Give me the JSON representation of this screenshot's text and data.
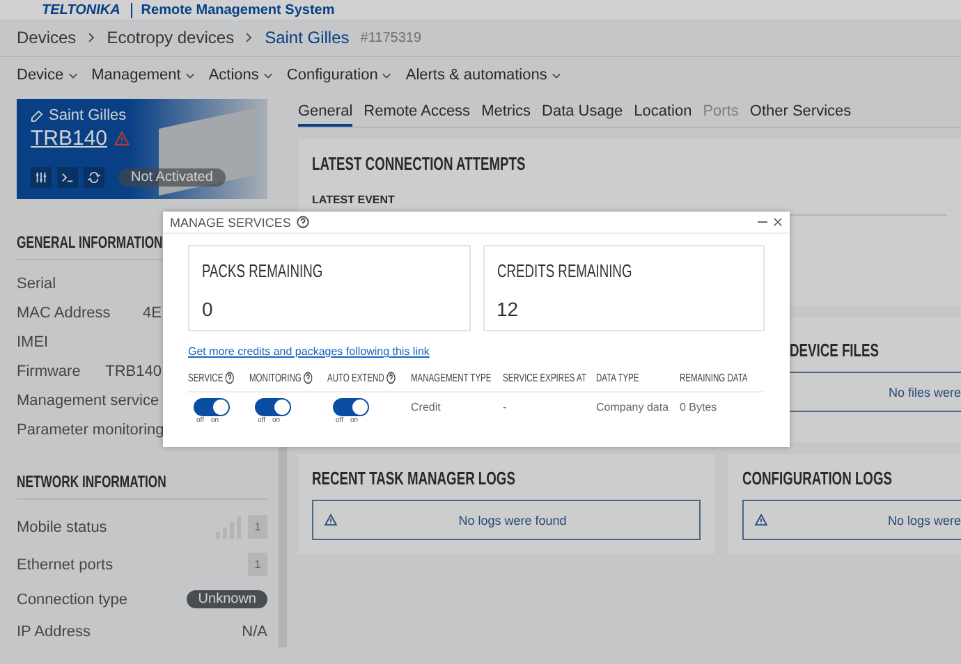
{
  "header": {
    "logo": "TELTONIKA",
    "title": "Remote Management System"
  },
  "breadcrumbs": [
    {
      "label": "Devices",
      "current": false
    },
    {
      "label": "Ecotropy devices",
      "current": false
    },
    {
      "label": "Saint Gilles",
      "current": true
    }
  ],
  "device_id": "#1175319",
  "menu": [
    "Device",
    "Management",
    "Actions",
    "Configuration",
    "Alerts & automations"
  ],
  "device_card": {
    "name": "Saint Gilles",
    "model": "TRB140",
    "warning": true,
    "status": "Not Activated"
  },
  "general_information": {
    "title": "GENERAL INFORMATION",
    "rows": [
      {
        "label": "Serial"
      },
      {
        "label": "MAC Address",
        "value": "4E"
      },
      {
        "label": "IMEI"
      },
      {
        "label": "Firmware",
        "value": "TRB140"
      },
      {
        "label": "Management service"
      },
      {
        "label": "Parameter monitoring"
      }
    ]
  },
  "network_information": {
    "title": "NETWORK INFORMATION",
    "rows": [
      {
        "label": "Mobile status",
        "kind": "signal",
        "value": "1"
      },
      {
        "label": "Ethernet ports",
        "kind": "port",
        "value": "1"
      },
      {
        "label": "Connection type",
        "kind": "badge",
        "value": "Unknown"
      },
      {
        "label": "IP Address",
        "kind": "text",
        "value": "N/A"
      }
    ]
  },
  "tabs": [
    {
      "label": "General",
      "selected": true,
      "disabled": false
    },
    {
      "label": "Remote Access",
      "selected": false,
      "disabled": false
    },
    {
      "label": "Metrics",
      "selected": false,
      "disabled": false
    },
    {
      "label": "Data Usage",
      "selected": false,
      "disabled": false
    },
    {
      "label": "Location",
      "selected": false,
      "disabled": false
    },
    {
      "label": "Ports",
      "selected": false,
      "disabled": true
    },
    {
      "label": "Other Services",
      "selected": false,
      "disabled": false
    }
  ],
  "latest_connection": {
    "title": "LATEST CONNECTION ATTEMPTS",
    "label": "LATEST EVENT"
  },
  "device_files": {
    "title": "DEVICE FILES",
    "message": "No files were"
  },
  "task_logs": {
    "title": "RECENT TASK MANAGER LOGS",
    "message": "No logs were found"
  },
  "config_logs": {
    "title": "CONFIGURATION LOGS",
    "message": "No logs were"
  },
  "dialog": {
    "title": "MANAGE SERVICES",
    "stats": [
      {
        "label": "PACKS REMAINING",
        "value": "0"
      },
      {
        "label": "CREDITS REMAINING",
        "value": "12"
      }
    ],
    "link": "Get more credits and packages following this link",
    "columns": [
      {
        "label": "SERVICE",
        "help": true
      },
      {
        "label": "MONITORING",
        "help": true
      },
      {
        "label": "AUTO EXTEND",
        "help": true
      },
      {
        "label": "MANAGEMENT TYPE",
        "help": false
      },
      {
        "label": "SERVICE EXPIRES AT",
        "help": false
      },
      {
        "label": "DATA TYPE",
        "help": false
      },
      {
        "label": "REMAINING DATA",
        "help": false
      }
    ],
    "toggles": [
      {
        "on": true,
        "off_label": "off",
        "on_label": "on"
      },
      {
        "on": true,
        "off_label": "off",
        "on_label": "on"
      },
      {
        "on": true,
        "off_label": "off",
        "on_label": "on"
      }
    ],
    "cells": [
      "Credit",
      "-",
      "Company data",
      "0 Bytes"
    ]
  }
}
